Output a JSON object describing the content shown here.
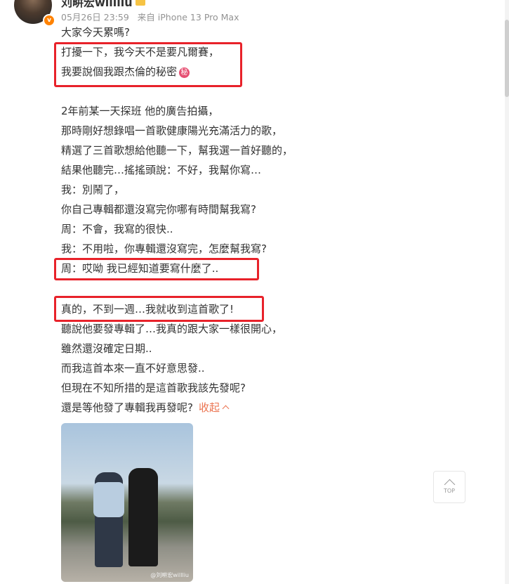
{
  "post": {
    "username": "刘畊宏willliu",
    "time": "05月26日 23:59",
    "source": "来自 iPhone 13 Pro Max",
    "verify_badge": "v",
    "lines": [
      "大家今天累嗎?",
      "打擾一下，我今天不是要凡爾賽，",
      "我要說個我跟杰倫的秘密",
      "2年前某一天探班 他的廣告拍攝，",
      "那時剛好想錄唱一首歌健康陽光充滿活力的歌，",
      "精選了三首歌想給他聽一下，幫我選一首好聽的，",
      "結果他聽完…搖搖頭說：不好，我幫你寫…",
      "我：別鬧了，",
      "你自己專輯都還沒寫完你哪有時間幫我寫?",
      "周：不會，我寫的很快..",
      "我：不用啦，你專輯還沒寫完，怎麼幫我寫?",
      "周：哎呦 我已經知道要寫什麼了..",
      "真的，不到一週…我就收到這首歌了!",
      "聽說他要發專輯了…我真的跟大家一樣很開心，",
      "雖然還沒確定日期..",
      "而我這首本來一直不好意思發..",
      "但現在不知所措的是這首歌我該先發呢?",
      "還是等他發了專輯我再發呢?"
    ],
    "secret_emoji": "秘",
    "collapse_label": "收起",
    "photo_watermark": "@刘畊宏willliu"
  },
  "ui": {
    "top_button_label": "TOP"
  },
  "colors": {
    "highlight_box": "#e8222a",
    "link": "#eb7350",
    "meta_text": "#939393"
  },
  "icons": [
    "crown-icon",
    "verified-icon",
    "secret-emoji-icon",
    "caret-up-icon",
    "top-arrow-icon"
  ]
}
